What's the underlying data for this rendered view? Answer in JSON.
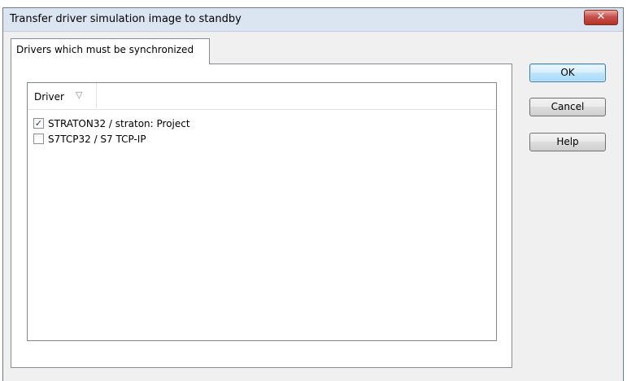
{
  "window": {
    "title": "Transfer driver simulation image to standby",
    "close_symbol": "✕"
  },
  "tab": {
    "label": "Drivers which must be synchronized"
  },
  "list": {
    "column_header": "Driver",
    "filter_icon": "filter-icon",
    "rows": [
      {
        "label": "STRATON32 / straton: Project",
        "checked": true
      },
      {
        "label": "S7TCP32 / S7 TCP-IP",
        "checked": false
      }
    ]
  },
  "buttons": {
    "ok": "OK",
    "cancel": "Cancel",
    "help": "Help"
  }
}
